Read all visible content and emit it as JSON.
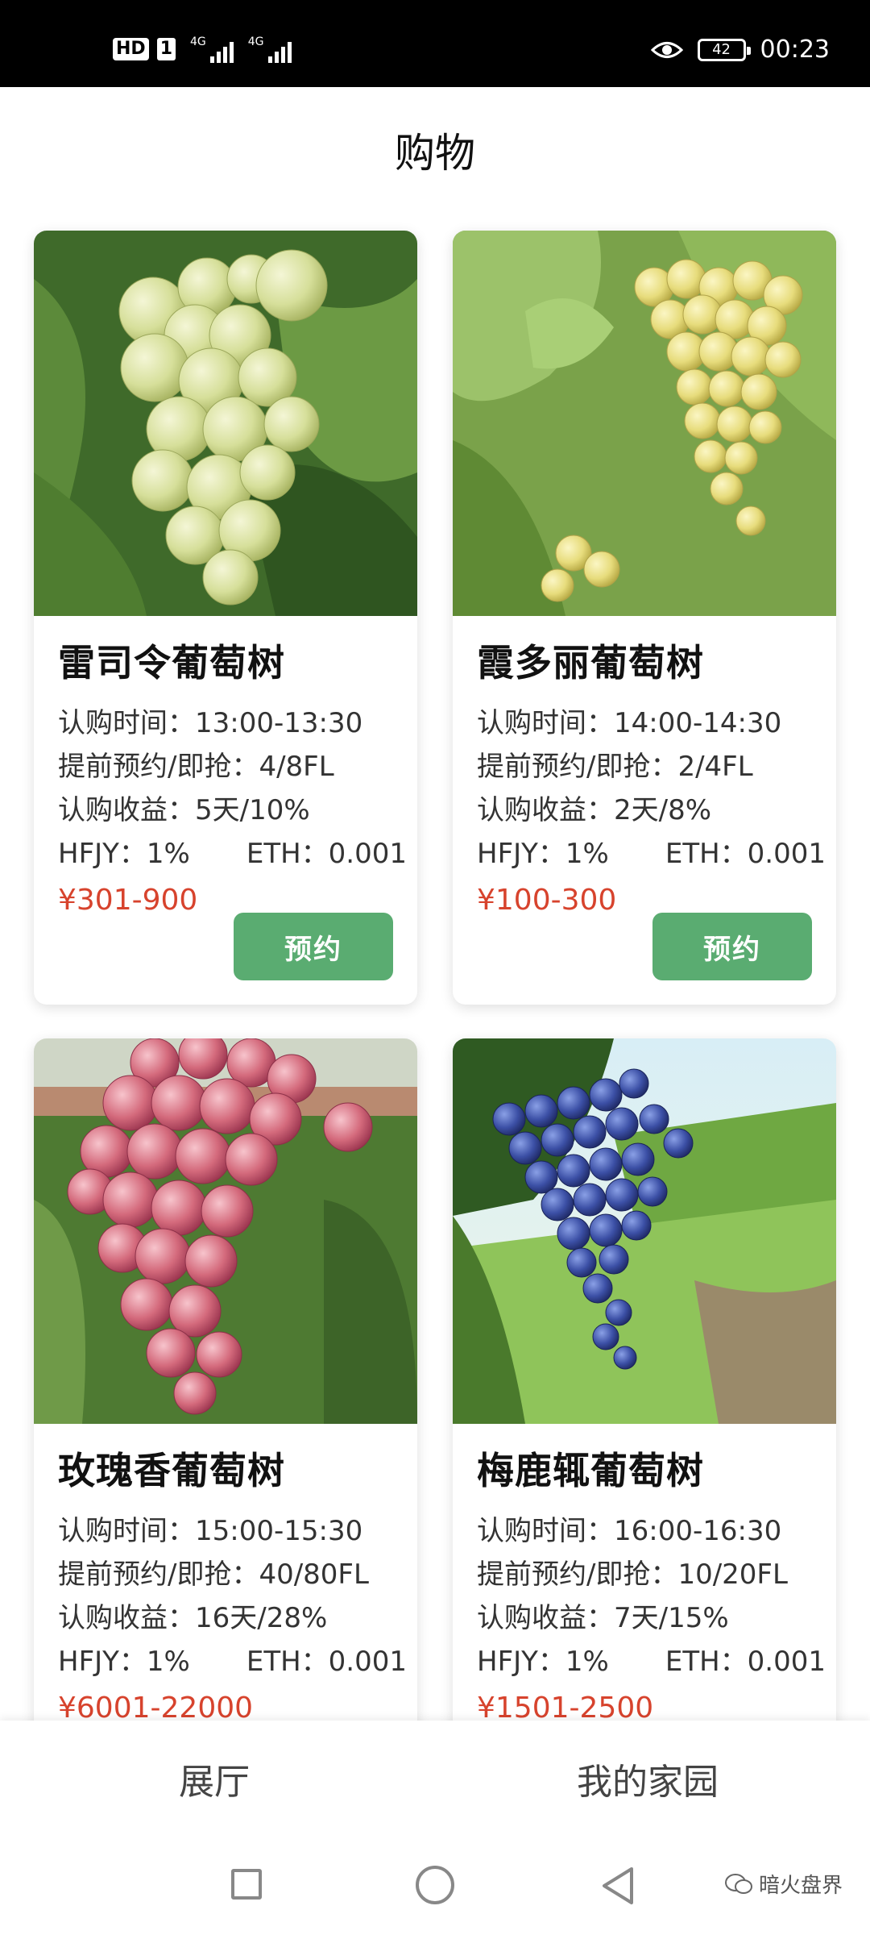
{
  "status_bar": {
    "hd_label": "HD",
    "sim_label": "1",
    "network_1": "4G",
    "network_2": "4G",
    "battery": "42",
    "time": "00:23"
  },
  "header": {
    "title": "购物"
  },
  "products": [
    {
      "name": "雷司令葡萄树",
      "time": "认购时间：13:00-13:30",
      "reserve": "提前预约/即抢：4/8FL",
      "income": "认购收益：5天/10%",
      "hfjy": "HFJY：1%",
      "eth": "ETH：0.001",
      "price": "¥301-900",
      "button": "预约",
      "image": "green-grapes"
    },
    {
      "name": "霞多丽葡萄树",
      "time": "认购时间：14:00-14:30",
      "reserve": "提前预约/即抢：2/4FL",
      "income": "认购收益：2天/8%",
      "hfjy": "HFJY：1%",
      "eth": "ETH：0.001",
      "price": "¥100-300",
      "button": "预约",
      "image": "white-grapes"
    },
    {
      "name": "玫瑰香葡萄树",
      "time": "认购时间：15:00-15:30",
      "reserve": "提前预约/即抢：40/80FL",
      "income": "认购收益：16天/28%",
      "hfjy": "HFJY：1%",
      "eth": "ETH：0.001",
      "price": "¥6001-22000",
      "image": "red-grapes"
    },
    {
      "name": "梅鹿辄葡萄树",
      "time": "认购时间：16:00-16:30",
      "reserve": "提前预约/即抢：10/20FL",
      "income": "认购收益：7天/15%",
      "hfjy": "HFJY：1%",
      "eth": "ETH：0.001",
      "price": "¥1501-2500",
      "image": "blue-grapes"
    }
  ],
  "tabs": [
    {
      "label": "展厅"
    },
    {
      "label": "我的家园"
    }
  ],
  "watermark": "暗火盘界",
  "colors": {
    "accent_green": "#5aac71",
    "price_red": "#d7432d"
  }
}
